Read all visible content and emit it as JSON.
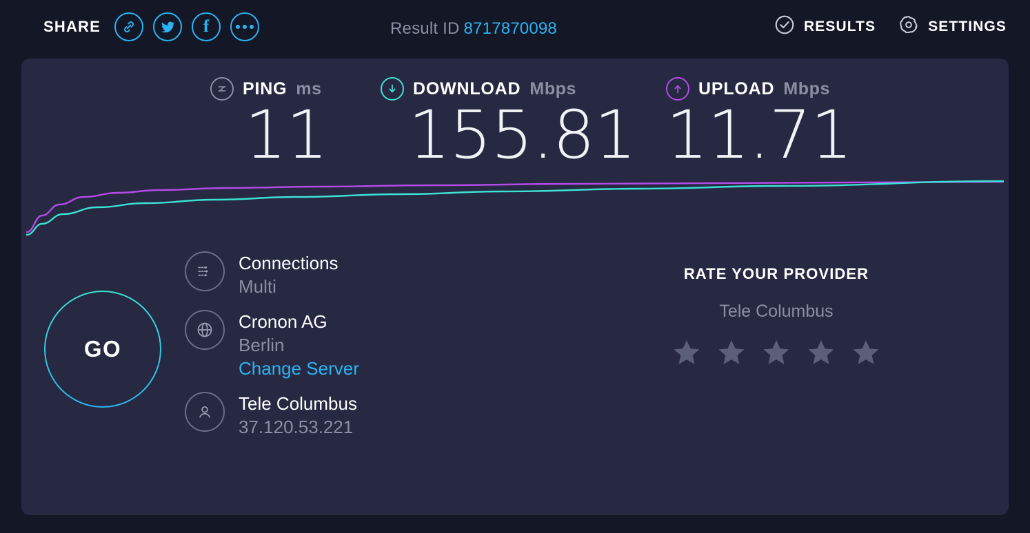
{
  "colors": {
    "page_background": "#141726",
    "panel_background": "#262941",
    "accent_blue": "#2BB3F3",
    "download_teal": "#3CE2D4",
    "upload_purple": "#B44BE8",
    "muted_text": "#8A8FA3",
    "star_empty": "#5B5F78",
    "white": "#FFFFFF"
  },
  "topbar": {
    "share_label": "SHARE",
    "share_buttons": [
      {
        "name": "link-icon",
        "title": "Copy link"
      },
      {
        "name": "twitter-icon",
        "title": "Twitter"
      },
      {
        "name": "facebook-icon",
        "title": "Facebook"
      },
      {
        "name": "more-icon",
        "title": "More"
      }
    ],
    "result_id_label": "Result ID",
    "result_id_value": "8717870098",
    "nav": [
      {
        "label": "RESULTS",
        "icon": "check-circle-icon"
      },
      {
        "label": "SETTINGS",
        "icon": "gear-icon"
      }
    ]
  },
  "metrics": {
    "ping": {
      "name": "PING",
      "unit": "ms",
      "value": "11"
    },
    "download": {
      "name": "DOWNLOAD",
      "unit": "Mbps",
      "value": "155.81"
    },
    "upload": {
      "name": "UPLOAD",
      "unit": "Mbps",
      "value": "11.71"
    }
  },
  "chart_data": {
    "type": "line",
    "title": "",
    "xlabel": "",
    "ylabel": "",
    "grid": false,
    "legend": "none",
    "xlim": [
      0,
      1432
    ],
    "ylim": [
      0,
      90
    ],
    "series": [
      {
        "name": "upload",
        "color": "#B44BE8",
        "points": [
          [
            8,
            84
          ],
          [
            30,
            60
          ],
          [
            55,
            44
          ],
          [
            90,
            33
          ],
          [
            140,
            27
          ],
          [
            200,
            23
          ],
          [
            300,
            20
          ],
          [
            430,
            18
          ],
          [
            600,
            16
          ],
          [
            800,
            14
          ],
          [
            1000,
            13
          ],
          [
            1200,
            12
          ],
          [
            1424,
            11
          ]
        ]
      },
      {
        "name": "download",
        "color": "#3CE2D4",
        "points": [
          [
            8,
            88
          ],
          [
            30,
            72
          ],
          [
            60,
            58
          ],
          [
            110,
            48
          ],
          [
            180,
            42
          ],
          [
            280,
            37
          ],
          [
            400,
            33
          ],
          [
            550,
            29
          ],
          [
            700,
            25
          ],
          [
            900,
            21
          ],
          [
            1100,
            17
          ],
          [
            1424,
            10
          ]
        ]
      }
    ]
  },
  "go_button": {
    "label": "GO"
  },
  "info": [
    {
      "icon": "connections-icon",
      "title": "Connections",
      "sub": "Multi",
      "link": ""
    },
    {
      "icon": "globe-icon",
      "title": "Cronon AG",
      "sub": "Berlin",
      "link": "Change Server"
    },
    {
      "icon": "user-icon",
      "title": "Tele Columbus",
      "sub": "37.120.53.221",
      "link": ""
    }
  ],
  "rate": {
    "title": "RATE YOUR PROVIDER",
    "provider": "Tele Columbus",
    "star_count": 5,
    "rating": 0
  }
}
